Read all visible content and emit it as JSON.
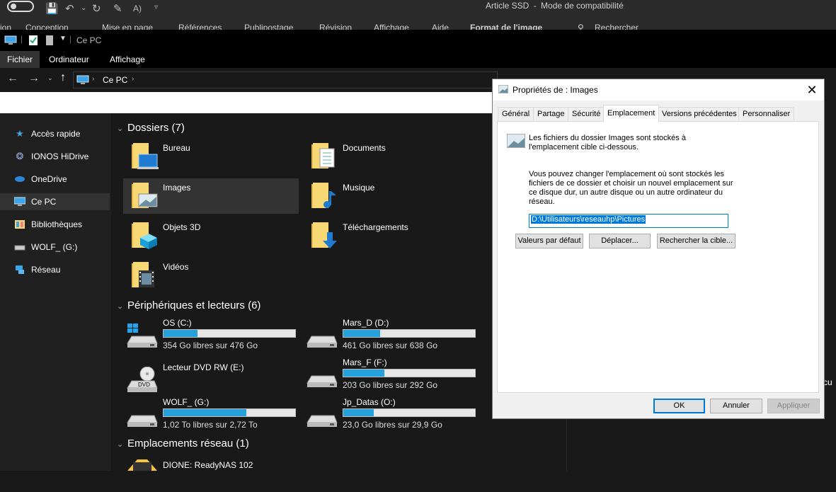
{
  "word": {
    "doc_title": "Article SSD",
    "separator": "-",
    "mode": "Mode de compatibilité",
    "ribbon_tabs": [
      "ion",
      "Conception",
      "Mise en page",
      "Références",
      "Publipostage",
      "Révision",
      "Affichage",
      "Aide",
      "Format de l'image"
    ],
    "search_label": "Rechercher"
  },
  "explorer": {
    "title": "Ce PC",
    "menu": [
      "Fichier",
      "Ordinateur",
      "Affichage"
    ],
    "breadcrumb": [
      "Ce PC"
    ],
    "sidebar": [
      {
        "label": "Accès rapide",
        "icon": "star-icon"
      },
      {
        "label": "IONOS HiDrive",
        "icon": "hidrive-icon"
      },
      {
        "label": "OneDrive",
        "icon": "cloud-icon"
      },
      {
        "label": "Ce PC",
        "icon": "computer-icon"
      },
      {
        "label": "Bibliothèques",
        "icon": "library-icon"
      },
      {
        "label": "WOLF_ (G:)",
        "icon": "drive-icon"
      },
      {
        "label": "Réseau",
        "icon": "network-icon"
      }
    ],
    "sections": {
      "folders_title": "Dossiers (7)",
      "devices_title": "Périphériques et lecteurs (6)",
      "network_title": "Emplacements réseau (1)"
    },
    "folders": [
      {
        "label": "Bureau",
        "icon": "desktop-folder-icon"
      },
      {
        "label": "Documents",
        "icon": "documents-folder-icon"
      },
      {
        "label": "Images",
        "icon": "pictures-folder-icon"
      },
      {
        "label": "Musique",
        "icon": "music-folder-icon"
      },
      {
        "label": "Objets 3D",
        "icon": "3d-objects-folder-icon"
      },
      {
        "label": "Téléchargements",
        "icon": "downloads-folder-icon"
      },
      {
        "label": "Vidéos",
        "icon": "videos-folder-icon"
      }
    ],
    "drives": [
      {
        "name": "OS (C:)",
        "free": "354 Go libres sur 476 Go",
        "used_fraction": 0.26
      },
      {
        "name": "Mars_D (D:)",
        "free": "461 Go libres sur 638 Go",
        "used_fraction": 0.28
      },
      {
        "name": "Lecteur DVD RW (E:)",
        "free": "",
        "used_fraction": null
      },
      {
        "name": "Mars_F (F:)",
        "free": "203 Go libres sur 292 Go",
        "used_fraction": 0.31
      },
      {
        "name": "WOLF_ (G:)",
        "free": "1,02 To libres sur 2,72 To",
        "used_fraction": 0.63
      },
      {
        "name": "Jp_Datas (O:)",
        "free": "23,0 Go libres sur 29,9 Go",
        "used_fraction": 0.23
      }
    ],
    "dvd_badge": "DVD",
    "network_locations": [
      {
        "name": "DIONE: ReadyNAS 102"
      }
    ],
    "right_edge_text": "cu"
  },
  "dialog": {
    "title": "Propriétés de : Images",
    "tabs": [
      "Général",
      "Partage",
      "Sécurité",
      "Emplacement",
      "Versions précédentes",
      "Personnaliser"
    ],
    "active_tab": "Emplacement",
    "info_line1": "Les fichiers du dossier Images sont stockés à",
    "info_line2": "l'emplacement cible ci-dessous.",
    "desc_line1": "Vous pouvez changer l'emplacement où sont stockés les",
    "desc_line2": "fichiers de ce dossier et choisir un nouvel emplacement sur",
    "desc_line3": "ce disque dur, un autre disque ou un autre ordinateur du",
    "desc_line4": "réseau.",
    "path_value": "D:\\Utilisateurs\\reseauhp\\Pictures",
    "btn_default": "Valeurs par défaut",
    "btn_move": "Déplacer...",
    "btn_find": "Rechercher la cible...",
    "btn_ok": "OK",
    "btn_cancel": "Annuler",
    "btn_apply": "Appliquer"
  },
  "colors": {
    "accent": "#0078d7",
    "drive_bar": "#26a0da",
    "folder_yellow": "#f8d775"
  }
}
